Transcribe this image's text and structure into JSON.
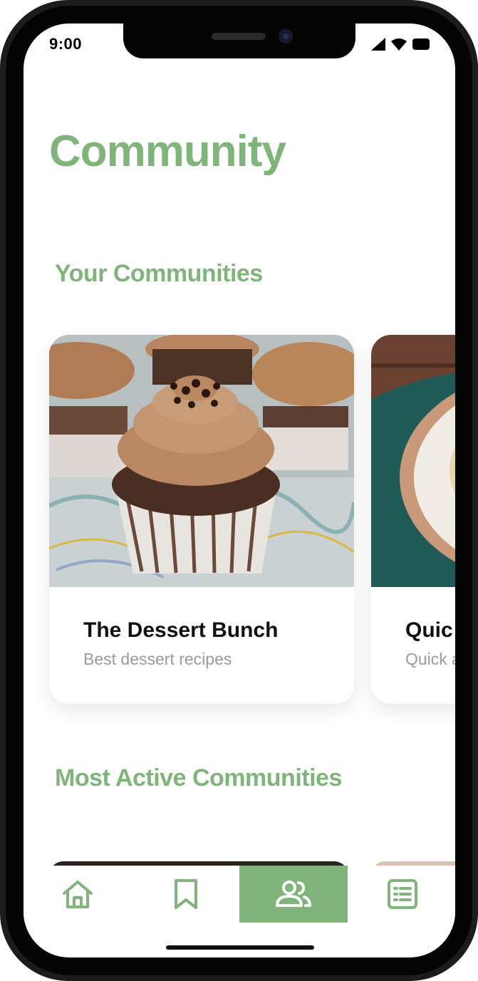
{
  "status_bar": {
    "time": "9:00",
    "icons": [
      "signal-icon",
      "wifi-icon",
      "battery-icon"
    ]
  },
  "page": {
    "title": "Community"
  },
  "your_communities": {
    "heading": "Your Communities",
    "cards": [
      {
        "title": "The Dessert Bunch",
        "subtitle": "Best dessert recipes",
        "image": "chocolate cupcakes photo"
      },
      {
        "title": "Quic",
        "subtitle": "Quick a",
        "image": "plate on teal cloth photo"
      }
    ]
  },
  "most_active": {
    "heading": "Most Active Communities"
  },
  "tab_bar": {
    "items": [
      {
        "icon": "home-icon",
        "active": false
      },
      {
        "icon": "bookmark-icon",
        "active": false
      },
      {
        "icon": "community-icon",
        "active": true
      },
      {
        "icon": "list-icon",
        "active": false
      }
    ]
  },
  "colors": {
    "accent": "#80b47b",
    "title_text": "#111111",
    "subtitle_text": "#9a9a9a"
  }
}
